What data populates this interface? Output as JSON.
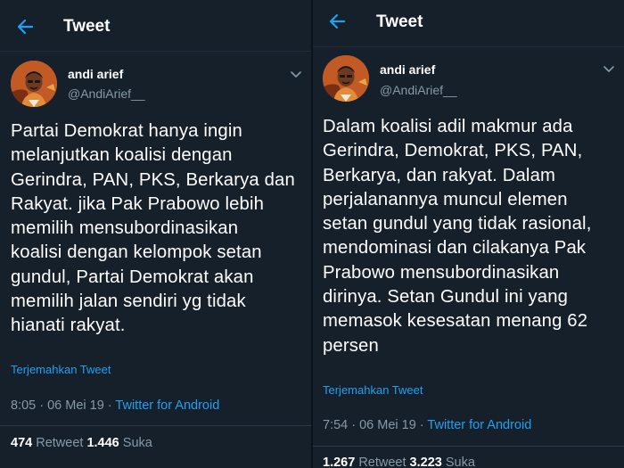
{
  "tweets": [
    {
      "header_title": "Tweet",
      "name": "andi arief",
      "handle": "@AndiArief__",
      "text": "Partai Demokrat hanya ingin\nmelanjutkan koalisi dengan\nGerindra, PAN, PKS, Berkarya dan\nRakyat. jika Pak Prabowo lebih\nmemilih mensubordinasikan\nkoalisi dengan kelompok setan\ngundul, Partai Demokrat akan\nmemilih jalan sendiri yg tidak\nhianati rakyat.",
      "translate": "Terjemahkan Tweet",
      "time": "8:05 · 06 Mei 19 · ",
      "source": "Twitter for Android",
      "retweet_count": "474",
      "retweet_label": " Retweet  ",
      "like_count": "1.446",
      "like_label": " Suka"
    },
    {
      "header_title": "Tweet",
      "name": "andi arief",
      "handle": "@AndiArief__",
      "text": "Dalam koalisi adil makmur ada\nGerindra, Demokrat, PKS, PAN,\nBerkarya, dan rakyat. Dalam\nperjalanannya  muncul elemen\nsetan gundul yang tidak rasional,\nmendominasi dan cilakanya Pak\nPrabowo mensubordinasikan\ndirinya. Setan Gundul ini yang\nmemasok kesesatan menang 62\npersen",
      "translate": "Terjemahkan Tweet",
      "time": "7:54 · 06 Mei 19 · ",
      "source": "Twitter for Android",
      "retweet_count": "1.267",
      "retweet_label": " Retweet  ",
      "like_count": "3.223",
      "like_label": " Suka"
    }
  ],
  "colors": {
    "background": "#15202b",
    "accent": "#1da1f2",
    "secondary_text": "#8899a6"
  },
  "icons": {
    "back": "arrow-left-icon",
    "menu": "chevron-down-icon",
    "avatar": "profile-photo"
  }
}
